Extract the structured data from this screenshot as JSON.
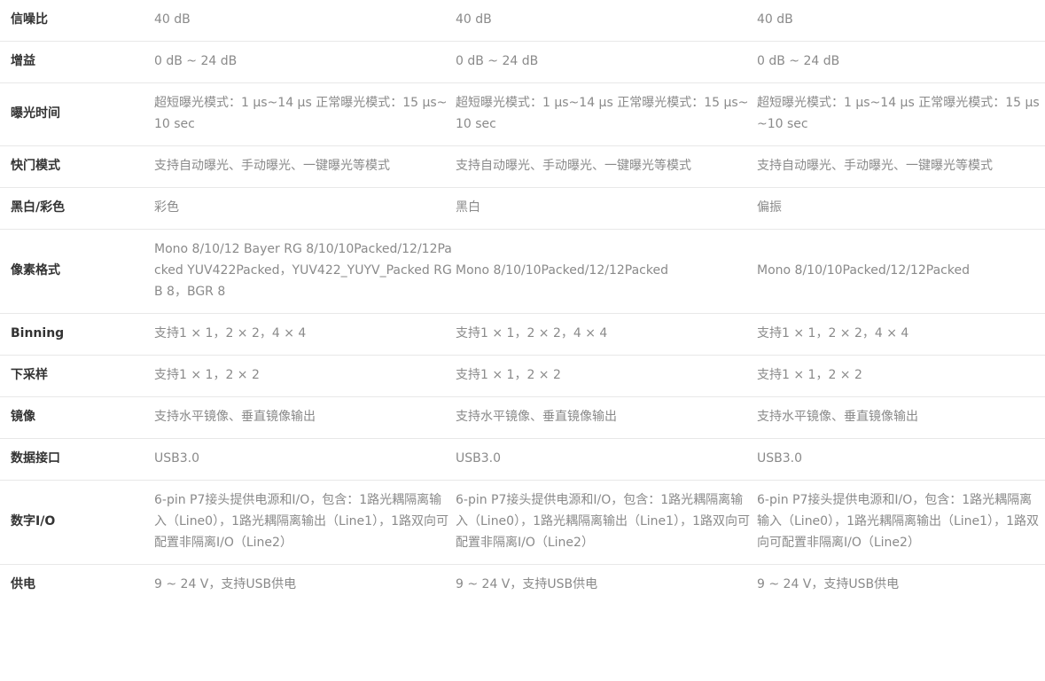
{
  "rows": [
    {
      "label": "信噪比",
      "values": [
        "40 dB",
        "40 dB",
        "40 dB"
      ]
    },
    {
      "label": "增益",
      "values": [
        "0 dB ~ 24 dB",
        "0 dB ~ 24 dB",
        "0 dB ~ 24 dB"
      ]
    },
    {
      "label": "曝光时间",
      "values": [
        "超短曝光模式：1 μs~14 μs 正常曝光模式：15 μs~10 sec",
        "超短曝光模式：1 μs~14 μs 正常曝光模式：15 μs~10 sec",
        "超短曝光模式：1 μs~14 μs 正常曝光模式：15 μs~10 sec"
      ]
    },
    {
      "label": "快门模式",
      "values": [
        "支持自动曝光、手动曝光、一键曝光等模式",
        "支持自动曝光、手动曝光、一键曝光等模式",
        "支持自动曝光、手动曝光、一键曝光等模式"
      ]
    },
    {
      "label": "黑白/彩色",
      "values": [
        "彩色",
        "黑白",
        "偏振"
      ]
    },
    {
      "label": "像素格式",
      "values": [
        "Mono 8/10/12 Bayer RG 8/10/10Packed/12/12Packed YUV422Packed，YUV422_YUYV_Packed RGB 8，BGR 8",
        "Mono 8/10/10Packed/12/12Packed",
        "Mono 8/10/10Packed/12/12Packed"
      ]
    },
    {
      "label": "Binning",
      "values": [
        "支持1 × 1，2 × 2，4 × 4",
        "支持1 × 1，2 × 2，4 × 4",
        "支持1 × 1，2 × 2，4 × 4"
      ]
    },
    {
      "label": "下采样",
      "values": [
        "支持1 × 1，2 × 2",
        "支持1 × 1，2 × 2",
        "支持1 × 1，2 × 2"
      ]
    },
    {
      "label": "镜像",
      "values": [
        "支持水平镜像、垂直镜像输出",
        "支持水平镜像、垂直镜像输出",
        "支持水平镜像、垂直镜像输出"
      ]
    },
    {
      "label": "数据接口",
      "values": [
        "USB3.0",
        "USB3.0",
        "USB3.0"
      ]
    },
    {
      "label": "数字I/O",
      "values": [
        "6-pin P7接头提供电源和I/O，包含：1路光耦隔离输入（Line0），1路光耦隔离输出（Line1），1路双向可配置非隔离I/O（Line2）",
        "6-pin P7接头提供电源和I/O，包含：1路光耦隔离输入（Line0），1路光耦隔离输出（Line1），1路双向可配置非隔离I/O（Line2）",
        "6-pin P7接头提供电源和I/O，包含：1路光耦隔离输入（Line0），1路光耦隔离输出（Line1），1路双向可配置非隔离I/O（Line2）"
      ]
    },
    {
      "label": "供电",
      "values": [
        "9 ~ 24 V，支持USB供电",
        "9 ~ 24 V，支持USB供电",
        "9 ~ 24 V，支持USB供电"
      ]
    }
  ]
}
